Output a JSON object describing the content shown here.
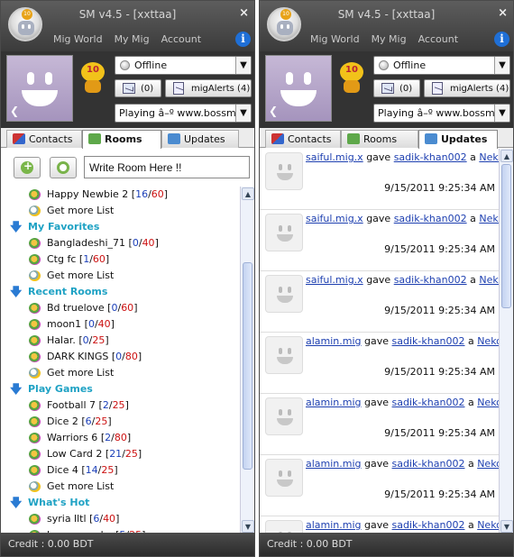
{
  "window_title": "SM v4.5 - [xxttaa]",
  "close_icon": "×",
  "nav": [
    "Mig World",
    "My Mig",
    "Account"
  ],
  "info_label": "i",
  "mascot_badge": "10",
  "status": "Offline",
  "mail_count": "(0)",
  "alerts": "migAlerts (4)",
  "playing": "Playing â–º www.bossmobi.com - B",
  "tabs": {
    "contacts": "Contacts",
    "rooms": "Rooms",
    "updates": "Updates"
  },
  "room_input": "Write Room Here !!",
  "credit": "Credit : 0.00 BDT",
  "rooms_list": [
    {
      "type": "item",
      "name": "Happy Newbie 2",
      "a": "16",
      "b": "60"
    },
    {
      "type": "more",
      "name": "Get more List"
    },
    {
      "type": "section",
      "name": "My Favorites"
    },
    {
      "type": "item",
      "name": "Bangladeshi_71",
      "a": "0",
      "b": "40"
    },
    {
      "type": "item",
      "name": "Ctg fc",
      "a": "1",
      "b": "60"
    },
    {
      "type": "more",
      "name": "Get more List"
    },
    {
      "type": "section",
      "name": "Recent Rooms"
    },
    {
      "type": "item",
      "name": "Bd truelove",
      "a": "0",
      "b": "60"
    },
    {
      "type": "item",
      "name": "moon1",
      "a": "0",
      "b": "40"
    },
    {
      "type": "item",
      "name": "Halar.",
      "a": "0",
      "b": "25"
    },
    {
      "type": "item",
      "name": "DARK KINGS",
      "a": "0",
      "b": "80"
    },
    {
      "type": "more",
      "name": "Get more List"
    },
    {
      "type": "section",
      "name": "Play Games"
    },
    {
      "type": "item",
      "name": "Football 7",
      "a": "2",
      "b": "25"
    },
    {
      "type": "item",
      "name": "Dice 2",
      "a": "6",
      "b": "25"
    },
    {
      "type": "item",
      "name": "Warriors 6",
      "a": "2",
      "b": "80"
    },
    {
      "type": "item",
      "name": "Low Card 2",
      "a": "21",
      "b": "25"
    },
    {
      "type": "item",
      "name": "Dice 4",
      "a": "14",
      "b": "25"
    },
    {
      "type": "more",
      "name": "Get more List"
    },
    {
      "type": "section",
      "name": "What's Hot"
    },
    {
      "type": "item",
      "name": "syria lltl",
      "a": "6",
      "b": "40"
    },
    {
      "type": "item",
      "name": "bangsang_ku",
      "a": "5",
      "b": "25"
    }
  ],
  "updates": [
    {
      "user": "saiful.mig.x",
      "verb": "gave",
      "target": "sadik-khan002",
      "a": "a",
      "gift": "Neko",
      "time": "9/15/2011 9:25:34 AM"
    },
    {
      "user": "saiful.mig.x",
      "verb": "gave",
      "target": "sadik-khan002",
      "a": "a",
      "gift": "Neko",
      "time": "9/15/2011 9:25:34 AM"
    },
    {
      "user": "saiful.mig.x",
      "verb": "gave",
      "target": "sadik-khan002",
      "a": "a",
      "gift": "Neko",
      "time": "9/15/2011 9:25:34 AM"
    },
    {
      "user": "alamin.mig",
      "verb": "gave",
      "target": "sadik-khan002",
      "a": "a",
      "gift": "Neko",
      "time": "9/15/2011 9:25:34 AM"
    },
    {
      "user": "alamin.mig",
      "verb": "gave",
      "target": "sadik-khan002",
      "a": "a",
      "gift": "Neko",
      "time": "9/15/2011 9:25:34 AM"
    },
    {
      "user": "alamin.mig",
      "verb": "gave",
      "target": "sadik-khan002",
      "a": "a",
      "gift": "Neko",
      "time": "9/15/2011 9:25:34 AM"
    },
    {
      "user": "alamin.mig",
      "verb": "gave",
      "target": "sadik-khan002",
      "a": "a",
      "gift": "Neko",
      "time": "9/15/2011 9:25:34 AM"
    }
  ],
  "colors": {
    "header": "#4a4a4a",
    "section": "#1fa2c4",
    "count_a": "#1b3fb8",
    "count_b": "#cc1111",
    "link": "#1d3fb0"
  },
  "icons": [
    "logo-icon",
    "close-icon",
    "info-icon",
    "avatar-icon",
    "mascot-icon",
    "status-dot-icon",
    "mail-icon",
    "alert-icon",
    "contacts-tab-icon",
    "rooms-tab-icon",
    "updates-tab-icon",
    "add-room-icon",
    "refresh-icon",
    "room-icon",
    "more-list-icon",
    "section-arrow-icon"
  ]
}
